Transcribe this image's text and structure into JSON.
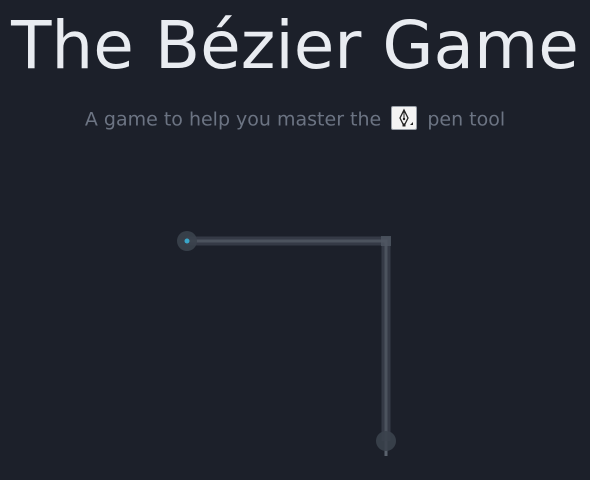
{
  "header": {
    "title": "The Bézier Game",
    "subtitle_before": "A game to help you master the",
    "subtitle_after": "pen tool",
    "pen_icon": "pen-tool-icon"
  },
  "game": {
    "target_path": "corner-path",
    "colors": {
      "background": "#1c202a",
      "path": "#4d5460",
      "path_highlight": "#5c6370",
      "anchor": "#3c434e",
      "start_anchor_accent": "#3aa6c9",
      "title": "#e9ecf1",
      "subtitle": "#6c7483"
    }
  }
}
